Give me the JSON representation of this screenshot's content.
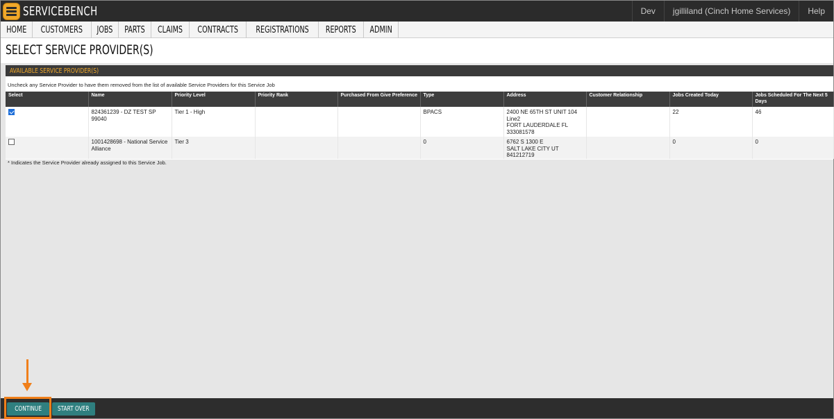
{
  "app": {
    "brand": "SERVICEBENCH"
  },
  "top_right": {
    "env": "Dev",
    "user": "jgilliland (Cinch Home Services)",
    "help": "Help"
  },
  "nav": [
    "HOME",
    "CUSTOMERS",
    "JOBS",
    "PARTS",
    "CLAIMS",
    "CONTRACTS",
    "REGISTRATIONS",
    "REPORTS",
    "ADMIN"
  ],
  "page_title": "SELECT SERVICE PROVIDER(S)",
  "panel": {
    "header": "AVAILABLE SERVICE PROVIDER(S)",
    "instruction": "Uncheck any Service Provider to have them removed from the list of available Service Providers for this Service Job",
    "columns": [
      "Select",
      "Name",
      "Priority Level",
      "Priority Rank",
      "Purchased From Give Preference",
      "Type",
      "Address",
      "Customer Relationship",
      "Jobs Created Today",
      "Jobs Scheduled For The Next 5 Days"
    ],
    "rows": [
      {
        "selected": true,
        "name": "824361239 - DZ TEST SP 99040",
        "priority_level": "Tier 1 - High",
        "priority_rank": "",
        "purchased_from": "",
        "type": "BPACS",
        "address_line1": "2400 NE 65TH ST UNIT 104",
        "address_line2": "Line2",
        "address_line3": "FORT LAUDERDALE FL",
        "address_line4": "333081578",
        "customer_relationship": "",
        "jobs_today": "22",
        "jobs_next5": "46"
      },
      {
        "selected": false,
        "name": "1001428698 - National Service Alliance",
        "priority_level": "Tier 3",
        "priority_rank": "",
        "purchased_from": "",
        "type": "0",
        "address_line1": "6762 S 1300 E",
        "address_line2": "SALT LAKE CITY UT 841212719",
        "address_line3": "",
        "address_line4": "",
        "customer_relationship": "",
        "jobs_today": "0",
        "jobs_next5": "0"
      }
    ],
    "footnote": "* Indicates the Service Provider already assigned to this Service Job."
  },
  "buttons": {
    "continue": "CONTINUE",
    "start_over": "START OVER"
  },
  "colors": {
    "accent": "#f0a82a",
    "button": "#2f7f7f",
    "annotation": "#f07f1a"
  }
}
